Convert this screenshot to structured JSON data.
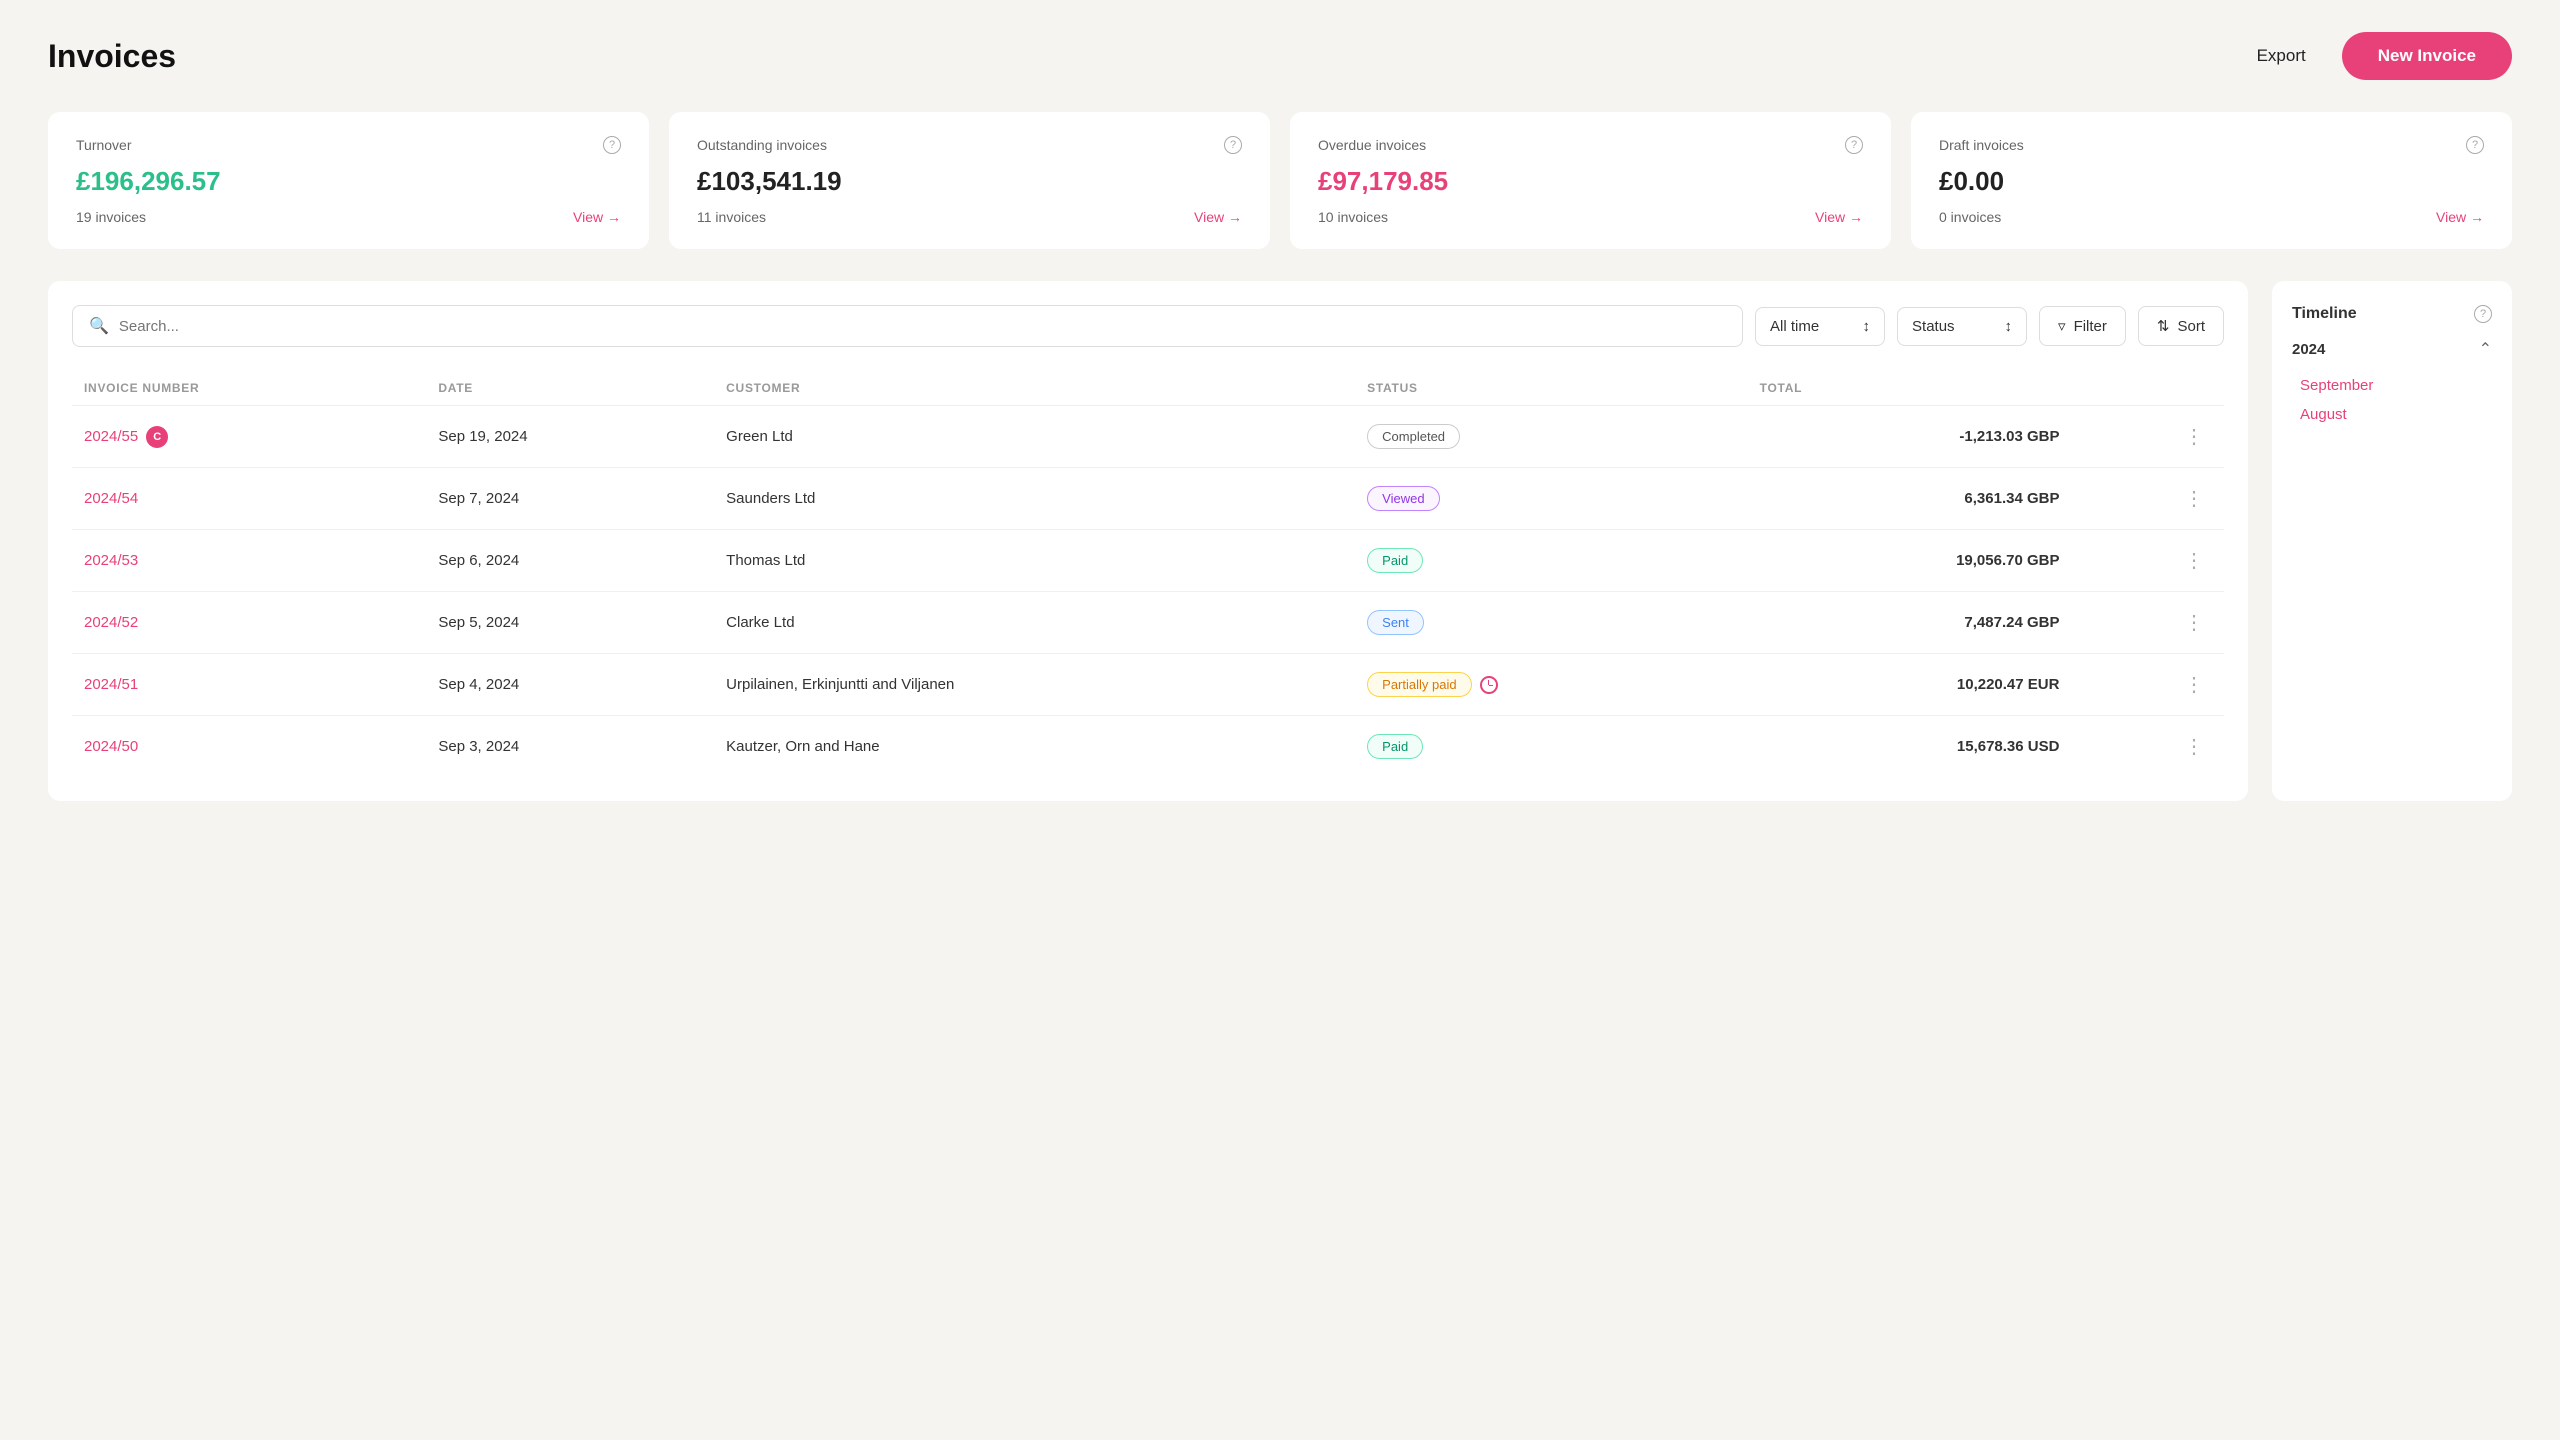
{
  "page": {
    "title": "Invoices"
  },
  "header": {
    "export_label": "Export",
    "new_invoice_label": "New Invoice"
  },
  "summary_cards": [
    {
      "label": "Turnover",
      "amount": "£196,296.57",
      "amount_class": "green",
      "count": "19 invoices",
      "view_label": "View →"
    },
    {
      "label": "Outstanding invoices",
      "amount": "£103,541.19",
      "amount_class": "black",
      "count": "11 invoices",
      "view_label": "View →"
    },
    {
      "label": "Overdue invoices",
      "amount": "£97,179.85",
      "amount_class": "red",
      "count": "10 invoices",
      "view_label": "View →"
    },
    {
      "label": "Draft invoices",
      "amount": "£0.00",
      "amount_class": "black",
      "count": "0 invoices",
      "view_label": "View →"
    }
  ],
  "toolbar": {
    "search_placeholder": "Search...",
    "all_time_label": "All time",
    "status_label": "Status",
    "filter_label": "Filter",
    "sort_label": "Sort"
  },
  "table": {
    "columns": [
      "INVOICE NUMBER",
      "DATE",
      "CUSTOMER",
      "STATUS",
      "TOTAL"
    ],
    "rows": [
      {
        "number": "2024/55",
        "badge": "C",
        "date": "Sep 19, 2024",
        "customer": "Green Ltd",
        "status": "Completed",
        "status_class": "badge-completed",
        "total": "-1,213.03 GBP"
      },
      {
        "number": "2024/54",
        "badge": "",
        "date": "Sep 7, 2024",
        "customer": "Saunders Ltd",
        "status": "Viewed",
        "status_class": "badge-viewed",
        "total": "6,361.34 GBP"
      },
      {
        "number": "2024/53",
        "badge": "",
        "date": "Sep 6, 2024",
        "customer": "Thomas Ltd",
        "status": "Paid",
        "status_class": "badge-paid",
        "total": "19,056.70 GBP"
      },
      {
        "number": "2024/52",
        "badge": "",
        "date": "Sep 5, 2024",
        "customer": "Clarke Ltd",
        "status": "Sent",
        "status_class": "badge-sent",
        "total": "7,487.24 GBP"
      },
      {
        "number": "2024/51",
        "badge": "",
        "date": "Sep 4, 2024",
        "customer": "Urpilainen, Erkinjuntti and Viljanen",
        "status": "Partially paid",
        "status_class": "badge-partial",
        "total": "10,220.47 EUR",
        "has_clock": true
      },
      {
        "number": "2024/50",
        "badge": "",
        "date": "Sep 3, 2024",
        "customer": "Kautzer, Orn and Hane",
        "status": "Paid",
        "status_class": "badge-paid",
        "total": "15,678.36 USD"
      }
    ]
  },
  "timeline": {
    "title": "Timeline",
    "year": "2024",
    "months": [
      "September",
      "August"
    ]
  }
}
